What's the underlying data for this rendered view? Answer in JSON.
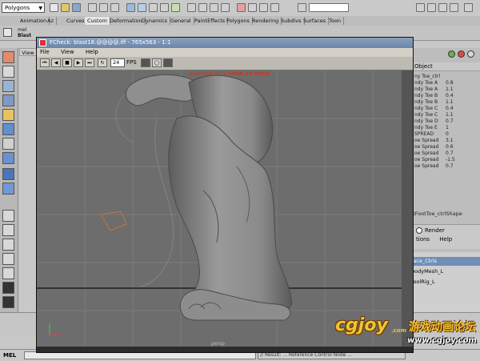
{
  "maya": {
    "mode_select": "Polygons",
    "shelf_tabs": [
      "Animation",
      "Az",
      "Curves",
      "Custom",
      "Deformation",
      "Dynamics",
      "General",
      "PaintEffects",
      "Polygons",
      "Rendering",
      "Subdivs",
      "Surfaces",
      "Toon"
    ],
    "active_shelf_tab": "Custom",
    "mini_mel": "mel",
    "mini_blast": "Blast",
    "view_tab": "View",
    "channel_header": "Object",
    "channel_rows": [
      {
        "label": "ny Toe_ctrl",
        "value": ""
      },
      {
        "label": "ndy Toe A",
        "value": "0.8"
      },
      {
        "label": "ndy Toe A",
        "value": "1.1"
      },
      {
        "label": "ndy Toe B",
        "value": "0.4"
      },
      {
        "label": "ndy Toe B",
        "value": "1.1"
      },
      {
        "label": "ndy Toe C",
        "value": "0.4"
      },
      {
        "label": "ndy Toe C",
        "value": "1.1"
      },
      {
        "label": "ndy Toe D",
        "value": "0.7"
      },
      {
        "label": "ndy Toe E",
        "value": "1"
      },
      {
        "label": "SPREAD",
        "value": "0"
      },
      {
        "label": "oe Spread",
        "value": "3.1"
      },
      {
        "label": "oe Spread",
        "value": "0.6"
      },
      {
        "label": "oe Spread",
        "value": "0.7"
      },
      {
        "label": "oe Spread",
        "value": "-1.5"
      },
      {
        "label": "oe Spread",
        "value": "0.7"
      }
    ],
    "shape_line": "ftFootToe_ctrlShape",
    "layer_render": "Render",
    "layer_menu": [
      "tions",
      "Help"
    ],
    "layers": [
      {
        "name": "face_Ctrls",
        "selected": true
      },
      {
        "name": "bodyMesh_L",
        "selected": false
      },
      {
        "name": "toolRig_L",
        "selected": false
      }
    ],
    "mel_label": "MEL",
    "command_result": "// Result: ... Reference Control Node ..."
  },
  "fcheck": {
    "title": "FCheck: blast18.@@@@.iff - 765x563 - 1:1",
    "menu": [
      "File",
      "View",
      "Help"
    ],
    "fps_value": "24",
    "fps_label": "FPS",
    "status_overlay": "ascii.txt   YT 1 MMA 24 MAYA",
    "axis_label": "persp"
  },
  "watermark": {
    "logo": "cgjoy",
    "logo_suffix": ".com",
    "chinese": "游戏动画论坛",
    "url": "www.cgjoy.com"
  },
  "colors": {
    "viewport_bg": "#6d6d6d",
    "title_bar": "#6c85a8",
    "selected_layer": "#6f8fb8",
    "watermark_gold": "#f2c530"
  }
}
